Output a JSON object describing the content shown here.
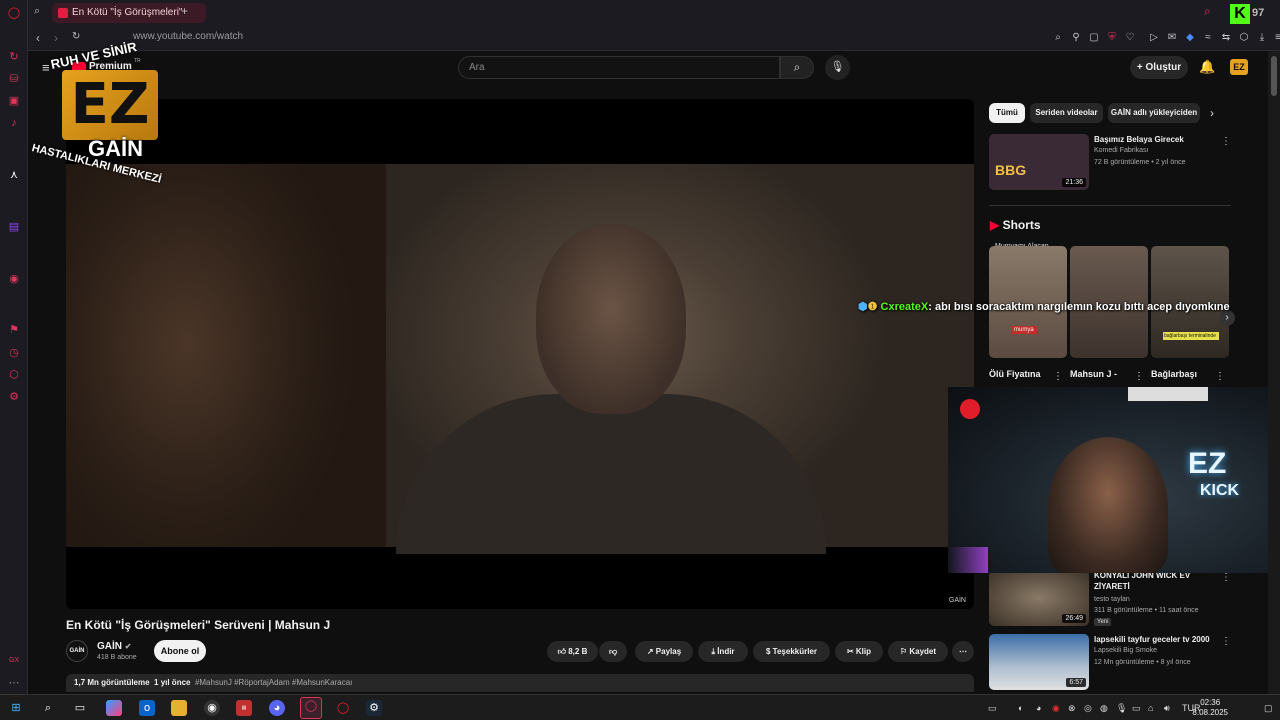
{
  "browser": {
    "tab_title": "En Kötü \"İş Görüşmeleri\"",
    "new_tab": "+",
    "url": "www.youtube.com/watch"
  },
  "youtube": {
    "logo_text": "Premium",
    "logo_sup": "TR",
    "search_placeholder": "Ara",
    "create_label": "Oluştur",
    "avatar_label": "EZ"
  },
  "overlay_logo": {
    "ring_top": "RUH VE SİNİR",
    "ring_bottom": "HASTALIKLARI MERKEZİ",
    "big": "EZ",
    "gain": "GAİN"
  },
  "player": {
    "watermark": "GAİN"
  },
  "video": {
    "title": "En Kötü \"İş Görüşmeleri\" Serüveni | Mahsun J",
    "channel_name": "GAİN",
    "channel_avatar": "GAİN",
    "subscribers": "418 B abone",
    "subscribe_label": "Abone ol",
    "likes": "8,2 B",
    "share_label": "Paylaş",
    "download_label": "İndir",
    "thanks_label": "Teşekkürler",
    "clip_label": "Klip",
    "save_label": "Kaydet",
    "more_label": "⋯",
    "views": "1,7 Mn görüntüleme",
    "age": "1 yıl önce",
    "tags": "#MahsunJ #RöportajAdam #MahsunKaracaı"
  },
  "chips": [
    "Tümü",
    "Seriden videolar",
    "GAİN adlı yükleyiciden"
  ],
  "recommendations": [
    {
      "title": "Başımız Belaya Girecek",
      "channel": "Komedi Fabrikası",
      "meta": "72 B görüntüleme • 2 yıl önce",
      "duration": "21:36",
      "thumb_label": "BBG",
      "thumb_color": "#3a2a36"
    },
    {
      "title": "KONYALI JOHN WICK EV ZİYARETİ",
      "channel": "testo taylan",
      "meta": "311 B görüntüleme • 11 saat önce",
      "badge": "Yeni",
      "duration": "26:49",
      "thumb_color": "#4a4036"
    },
    {
      "title": "lapsekili tayfur geceler tv 2000",
      "channel": "Lapsekili Big Smoke",
      "meta": "12 Mn görüntüleme • 8 yıl önce",
      "duration": "6:57",
      "thumb_color": "#3b6ea8"
    }
  ],
  "shorts": {
    "heading": "Shorts",
    "header_text": "Mumyamı Alacan",
    "items": [
      {
        "title": "Ölü Fiyatına",
        "caption": "mumya",
        "color": "#7a6a5c"
      },
      {
        "title": "Mahsun J -",
        "caption": "",
        "color": "#5c5048"
      },
      {
        "title": "Bağlarbaşı",
        "caption": "bağlarbaşı terminalinde",
        "color": "#4e463e"
      }
    ]
  },
  "chat": {
    "user": "CxreateX",
    "message": ": abı bısı soracaktım nargılemın kozu bıttı acep dıyomkıne"
  },
  "webcam": {
    "sign_top": "EZ",
    "sign_bottom": "KICK"
  },
  "taskbar": {
    "language": "TUR",
    "time": "02:36",
    "date": "8.08.2025"
  },
  "colors": {
    "accent": "#e0345a",
    "kick_green": "#53fc18",
    "yt_red": "#ff0033"
  }
}
